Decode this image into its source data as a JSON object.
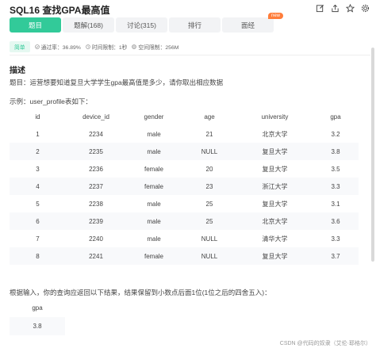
{
  "header": {
    "title": "SQL16  查找GPA最高值",
    "icons": [
      "edit-icon",
      "share-icon",
      "star-icon",
      "settings-icon"
    ]
  },
  "tabs": [
    {
      "label": "题目",
      "active": true
    },
    {
      "label": "题解(168)",
      "active": false
    },
    {
      "label": "讨论(315)",
      "active": false
    },
    {
      "label": "排行",
      "active": false
    },
    {
      "label": "面经",
      "active": false,
      "badge": "new"
    }
  ],
  "meta": {
    "difficulty": "简单",
    "pass_rate": "通过率：36.89%",
    "time_limit": "时间限制：1秒",
    "space_limit": "空间限制：256M"
  },
  "description": {
    "heading": "描述",
    "text": "题目：运营想要知道复旦大学学生gpa最高值是多少，请你取出相应数据",
    "example_label": "示例：user_profile表如下："
  },
  "table": {
    "columns": [
      "id",
      "device_id",
      "gender",
      "age",
      "university",
      "gpa"
    ],
    "rows": [
      [
        "1",
        "2234",
        "male",
        "21",
        "北京大学",
        "3.2"
      ],
      [
        "2",
        "2235",
        "male",
        "NULL",
        "复旦大学",
        "3.8"
      ],
      [
        "3",
        "2236",
        "female",
        "20",
        "复旦大学",
        "3.5"
      ],
      [
        "4",
        "2237",
        "female",
        "23",
        "浙江大学",
        "3.3"
      ],
      [
        "5",
        "2238",
        "male",
        "25",
        "复旦大学",
        "3.1"
      ],
      [
        "6",
        "2239",
        "male",
        "25",
        "北京大学",
        "3.6"
      ],
      [
        "7",
        "2240",
        "male",
        "NULL",
        "清华大学",
        "3.3"
      ],
      [
        "8",
        "2241",
        "female",
        "NULL",
        "复旦大学",
        "3.7"
      ]
    ]
  },
  "result": {
    "note": "根据输入，你的查询应返回以下结果，结果保留到小数点后面1位(1位之后的四舍五入)：",
    "header": "gpa",
    "value": "3.8"
  },
  "watermark": "CSDN @代码的奴隶（艾伦·耶格尔）",
  "colors": {
    "accent": "#32ca99",
    "badge": "#ff7d3a"
  }
}
